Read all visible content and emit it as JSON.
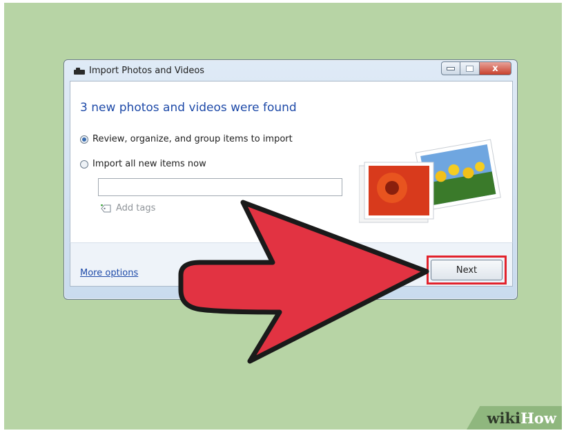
{
  "window": {
    "title": "Import Photos and Videos",
    "close_glyph": "x",
    "heading": "3 new photos and videos were found",
    "options": [
      {
        "label": "Review, organize, and group items to import",
        "selected": true
      },
      {
        "label": "Import all new items now",
        "selected": false
      }
    ],
    "tag_input_value": "",
    "add_tags_label": "Add tags",
    "more_options_label": "More options",
    "next_label": "Next"
  },
  "overlay": {
    "arrow_color": "#e23342",
    "highlight_color": "#e2222c"
  },
  "watermark": {
    "wiki": "wiki",
    "how": "How"
  }
}
